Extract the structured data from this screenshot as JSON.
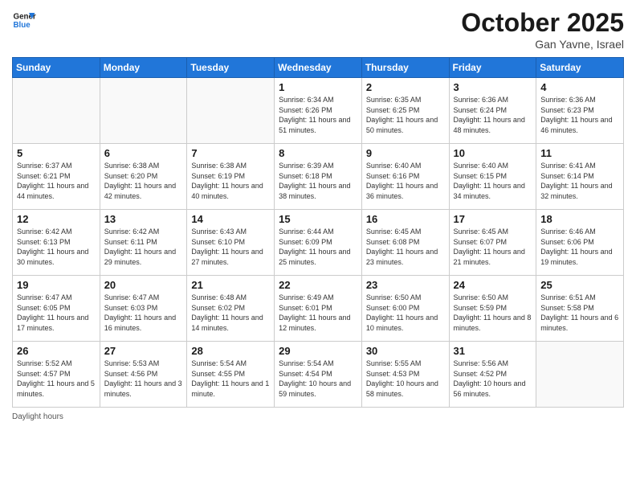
{
  "header": {
    "logo_line1": "General",
    "logo_line2": "Blue",
    "month_title": "October 2025",
    "location": "Gan Yavne, Israel"
  },
  "days_of_week": [
    "Sunday",
    "Monday",
    "Tuesday",
    "Wednesday",
    "Thursday",
    "Friday",
    "Saturday"
  ],
  "weeks": [
    [
      {
        "day": "",
        "info": ""
      },
      {
        "day": "",
        "info": ""
      },
      {
        "day": "",
        "info": ""
      },
      {
        "day": "1",
        "info": "Sunrise: 6:34 AM\nSunset: 6:26 PM\nDaylight: 11 hours\nand 51 minutes."
      },
      {
        "day": "2",
        "info": "Sunrise: 6:35 AM\nSunset: 6:25 PM\nDaylight: 11 hours\nand 50 minutes."
      },
      {
        "day": "3",
        "info": "Sunrise: 6:36 AM\nSunset: 6:24 PM\nDaylight: 11 hours\nand 48 minutes."
      },
      {
        "day": "4",
        "info": "Sunrise: 6:36 AM\nSunset: 6:23 PM\nDaylight: 11 hours\nand 46 minutes."
      }
    ],
    [
      {
        "day": "5",
        "info": "Sunrise: 6:37 AM\nSunset: 6:21 PM\nDaylight: 11 hours\nand 44 minutes."
      },
      {
        "day": "6",
        "info": "Sunrise: 6:38 AM\nSunset: 6:20 PM\nDaylight: 11 hours\nand 42 minutes."
      },
      {
        "day": "7",
        "info": "Sunrise: 6:38 AM\nSunset: 6:19 PM\nDaylight: 11 hours\nand 40 minutes."
      },
      {
        "day": "8",
        "info": "Sunrise: 6:39 AM\nSunset: 6:18 PM\nDaylight: 11 hours\nand 38 minutes."
      },
      {
        "day": "9",
        "info": "Sunrise: 6:40 AM\nSunset: 6:16 PM\nDaylight: 11 hours\nand 36 minutes."
      },
      {
        "day": "10",
        "info": "Sunrise: 6:40 AM\nSunset: 6:15 PM\nDaylight: 11 hours\nand 34 minutes."
      },
      {
        "day": "11",
        "info": "Sunrise: 6:41 AM\nSunset: 6:14 PM\nDaylight: 11 hours\nand 32 minutes."
      }
    ],
    [
      {
        "day": "12",
        "info": "Sunrise: 6:42 AM\nSunset: 6:13 PM\nDaylight: 11 hours\nand 30 minutes."
      },
      {
        "day": "13",
        "info": "Sunrise: 6:42 AM\nSunset: 6:11 PM\nDaylight: 11 hours\nand 29 minutes."
      },
      {
        "day": "14",
        "info": "Sunrise: 6:43 AM\nSunset: 6:10 PM\nDaylight: 11 hours\nand 27 minutes."
      },
      {
        "day": "15",
        "info": "Sunrise: 6:44 AM\nSunset: 6:09 PM\nDaylight: 11 hours\nand 25 minutes."
      },
      {
        "day": "16",
        "info": "Sunrise: 6:45 AM\nSunset: 6:08 PM\nDaylight: 11 hours\nand 23 minutes."
      },
      {
        "day": "17",
        "info": "Sunrise: 6:45 AM\nSunset: 6:07 PM\nDaylight: 11 hours\nand 21 minutes."
      },
      {
        "day": "18",
        "info": "Sunrise: 6:46 AM\nSunset: 6:06 PM\nDaylight: 11 hours\nand 19 minutes."
      }
    ],
    [
      {
        "day": "19",
        "info": "Sunrise: 6:47 AM\nSunset: 6:05 PM\nDaylight: 11 hours\nand 17 minutes."
      },
      {
        "day": "20",
        "info": "Sunrise: 6:47 AM\nSunset: 6:03 PM\nDaylight: 11 hours\nand 16 minutes."
      },
      {
        "day": "21",
        "info": "Sunrise: 6:48 AM\nSunset: 6:02 PM\nDaylight: 11 hours\nand 14 minutes."
      },
      {
        "day": "22",
        "info": "Sunrise: 6:49 AM\nSunset: 6:01 PM\nDaylight: 11 hours\nand 12 minutes."
      },
      {
        "day": "23",
        "info": "Sunrise: 6:50 AM\nSunset: 6:00 PM\nDaylight: 11 hours\nand 10 minutes."
      },
      {
        "day": "24",
        "info": "Sunrise: 6:50 AM\nSunset: 5:59 PM\nDaylight: 11 hours\nand 8 minutes."
      },
      {
        "day": "25",
        "info": "Sunrise: 6:51 AM\nSunset: 5:58 PM\nDaylight: 11 hours\nand 6 minutes."
      }
    ],
    [
      {
        "day": "26",
        "info": "Sunrise: 5:52 AM\nSunset: 4:57 PM\nDaylight: 11 hours\nand 5 minutes."
      },
      {
        "day": "27",
        "info": "Sunrise: 5:53 AM\nSunset: 4:56 PM\nDaylight: 11 hours\nand 3 minutes."
      },
      {
        "day": "28",
        "info": "Sunrise: 5:54 AM\nSunset: 4:55 PM\nDaylight: 11 hours\nand 1 minute."
      },
      {
        "day": "29",
        "info": "Sunrise: 5:54 AM\nSunset: 4:54 PM\nDaylight: 10 hours\nand 59 minutes."
      },
      {
        "day": "30",
        "info": "Sunrise: 5:55 AM\nSunset: 4:53 PM\nDaylight: 10 hours\nand 58 minutes."
      },
      {
        "day": "31",
        "info": "Sunrise: 5:56 AM\nSunset: 4:52 PM\nDaylight: 10 hours\nand 56 minutes."
      },
      {
        "day": "",
        "info": ""
      }
    ]
  ],
  "footer": {
    "daylight_label": "Daylight hours"
  }
}
